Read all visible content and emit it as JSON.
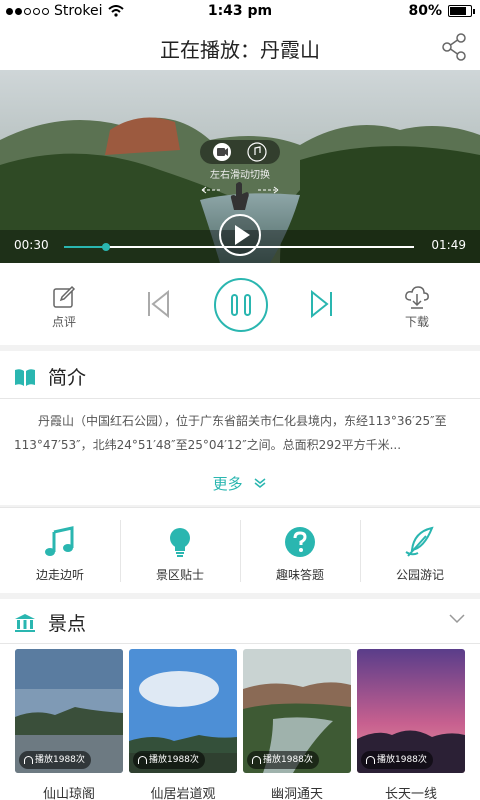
{
  "status_bar": {
    "carrier": "Strokei",
    "time": "1:43 pm",
    "battery_percent": "80%",
    "battery_level": 0.8
  },
  "header": {
    "title": "正在播放：丹霞山"
  },
  "video": {
    "swipe_hint": "左右滑动切换",
    "current_time": "00:30",
    "total_time": "01:49",
    "progress": 0.12
  },
  "controls": {
    "comment_label": "点评",
    "download_label": "下载"
  },
  "intro": {
    "title": "简介",
    "text": "丹霞山（中国红石公园），位于广东省韶关市仁化县境内，东经113°36′25″至113°47′53″，北纬24°51′48″至25°04′12″之间。总面积292平方千米...",
    "more_label": "更多"
  },
  "features": [
    {
      "label": "边走边听",
      "icon": "music-note-icon"
    },
    {
      "label": "景区贴士",
      "icon": "lightbulb-icon"
    },
    {
      "label": "趣味答题",
      "icon": "question-icon"
    },
    {
      "label": "公园游记",
      "icon": "feather-icon"
    }
  ],
  "scenic": {
    "title": "景点",
    "cards": [
      {
        "name": "仙山琼阁",
        "plays": "播放1988次"
      },
      {
        "name": "仙居岩道观",
        "plays": "播放1988次"
      },
      {
        "name": "幽洞通天",
        "plays": "播放1988次"
      },
      {
        "name": "长天一线",
        "plays": "播放1988次"
      }
    ]
  },
  "colors": {
    "accent": "#2ab6b0"
  }
}
